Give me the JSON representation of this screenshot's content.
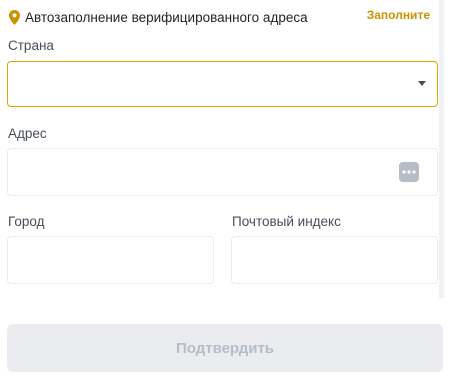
{
  "autofill": {
    "label": "Автозаполнение верифицированного адреса",
    "link_label": "Заполните",
    "icon": "location-pin-icon"
  },
  "form": {
    "country": {
      "label": "Страна",
      "value": "",
      "icon": "caret-down-icon"
    },
    "address": {
      "label": "Адрес",
      "value": "",
      "icon": "more-dots-icon"
    },
    "city": {
      "label": "Город",
      "value": ""
    },
    "postal_code": {
      "label": "Почтовый индекс",
      "value": ""
    }
  },
  "submit": {
    "label": "Подтвердить",
    "enabled": false
  },
  "colors": {
    "accent": "#c99400",
    "focus_border": "#d4a800",
    "border": "#eaecef",
    "disabled_bg": "#eaecef",
    "disabled_text": "#b7bdc6"
  }
}
